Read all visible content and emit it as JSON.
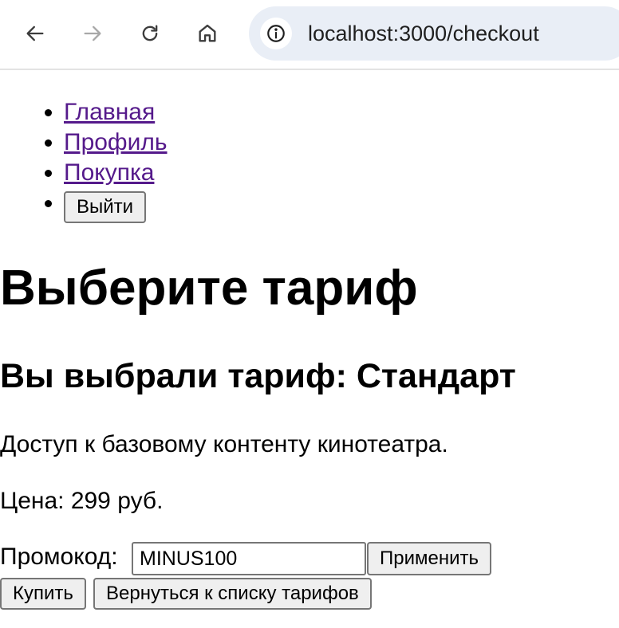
{
  "browser": {
    "url": "localhost:3000/checkout",
    "icons": {
      "back": "arrow-left-icon",
      "forward": "arrow-right-icon",
      "reload": "reload-icon",
      "home": "home-icon",
      "site_info": "info-icon"
    }
  },
  "nav": {
    "links": [
      {
        "label": "Главная"
      },
      {
        "label": "Профиль"
      },
      {
        "label": "Покупка"
      }
    ],
    "logout_label": "Выйти"
  },
  "main": {
    "title": "Выберите тариф",
    "selected_heading": "Вы выбрали тариф: Стандарт",
    "description": "Доступ к базовому контенту кинотеатра.",
    "price_label": "Цена:",
    "price_value": "299",
    "price_currency": "руб."
  },
  "promo": {
    "label": "Промокод:",
    "value": "MINUS100",
    "apply_label": "Применить"
  },
  "actions": {
    "buy_label": "Купить",
    "back_label": "Вернуться к списку тарифов"
  },
  "colors": {
    "link_visited": "#551a8b",
    "omnibox_bg": "#e9eef6",
    "button_bg": "#efefef",
    "button_border": "#767676"
  }
}
